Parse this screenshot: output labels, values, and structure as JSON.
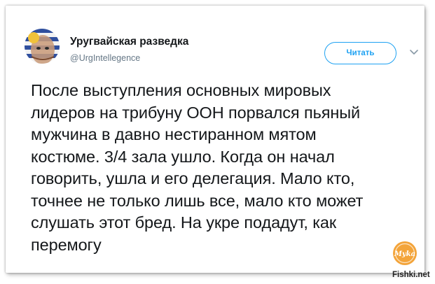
{
  "tweet": {
    "author_name": "Уругвайская разведка",
    "author_handle": "@UrgIntellegence",
    "follow_label": "Читать",
    "text": "После выступления основных мировых\nлидеров на трибуну ООН порвался пьяный\nмужчина в давно нестиранном мятом\nкостюме. 3/4 зала ушло. Когда он начал\nговорить, ушла и его делегация. Мало кто,\nточнее не только лишь все, мало кто может\nслушать этот бред. На укре подадут, как\nперемогу"
  },
  "watermark": {
    "logo_text": "Myka",
    "site": "Fishki.net"
  },
  "icons": {
    "avatar": "avatar-image",
    "more": "chevron-down-icon"
  },
  "colors": {
    "accent": "#1da1f2",
    "text": "#14171a",
    "secondary": "#657786"
  }
}
